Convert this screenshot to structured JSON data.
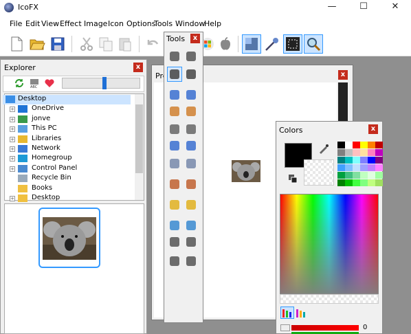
{
  "window": {
    "title": "IcoFX",
    "minimize": "—",
    "maximize": "☐",
    "close": "✕"
  },
  "menu": [
    "File",
    "Edit",
    "View",
    "Effect",
    "Image",
    "Icon",
    "Options",
    "Tools",
    "Window",
    "Help"
  ],
  "explorer": {
    "title": "Explorer",
    "tree": [
      {
        "label": "Desktop",
        "icon": "desktop-icon",
        "expander": false
      },
      {
        "label": "OneDrive",
        "icon": "cloud-icon",
        "expander": true
      },
      {
        "label": "jonve",
        "icon": "user-icon",
        "expander": true
      },
      {
        "label": "This PC",
        "icon": "computer-icon",
        "expander": true
      },
      {
        "label": "Libraries",
        "icon": "library-icon",
        "expander": true
      },
      {
        "label": "Network",
        "icon": "network-icon",
        "expander": true
      },
      {
        "label": "Homegroup",
        "icon": "homegroup-icon",
        "expander": true
      },
      {
        "label": "Control Panel",
        "icon": "control-panel-icon",
        "expander": true
      },
      {
        "label": "Recycle Bin",
        "icon": "recycle-bin-icon",
        "expander": false
      },
      {
        "label": "Books",
        "icon": "folder-icon",
        "expander": false
      },
      {
        "label": "Desktop",
        "icon": "folder-icon",
        "expander": true
      }
    ],
    "slider_level": 0.55
  },
  "tools": {
    "title": "Tools"
  },
  "preview": {
    "title": "Pre"
  },
  "colors": {
    "title": "Colors",
    "alpha_value": "0",
    "palette": [
      "#000000",
      "#ffffff",
      "#ff0000",
      "#ffff00",
      "#ff8000",
      "#c00000",
      "#808080",
      "#c0c0c0",
      "#ffc0c0",
      "#ffe0a0",
      "#ff80c0",
      "#c000c0",
      "#008080",
      "#00c0c0",
      "#80ffff",
      "#8080ff",
      "#0000ff",
      "#800080",
      "#40a0ff",
      "#80c0ff",
      "#c0e0ff",
      "#a0a0ff",
      "#c080ff",
      "#ff80ff",
      "#00a040",
      "#40c080",
      "#80e0a0",
      "#c0ffc0",
      "#e0ffe0",
      "#a0ffa0",
      "#008000",
      "#00c000",
      "#40ff40",
      "#80ff80",
      "#c0ff80",
      "#a0e060"
    ]
  }
}
